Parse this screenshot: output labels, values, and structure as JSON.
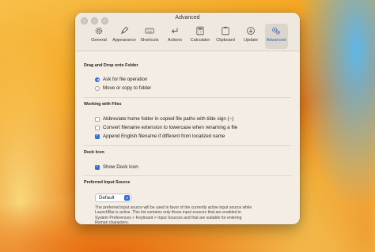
{
  "window": {
    "title": "Advanced"
  },
  "toolbar": {
    "items": [
      {
        "label": "General",
        "icon": "gear-icon"
      },
      {
        "label": "Appearance",
        "icon": "paintbrush-icon"
      },
      {
        "label": "Shortcuts",
        "icon": "keyboard-icon"
      },
      {
        "label": "Actions",
        "icon": "arrow-return-icon"
      },
      {
        "label": "Calculator",
        "icon": "calculator-icon"
      },
      {
        "label": "Clipboard",
        "icon": "clipboard-icon"
      },
      {
        "label": "Update",
        "icon": "download-circle-icon"
      },
      {
        "label": "Advanced",
        "icon": "gears-icon",
        "active": true
      }
    ]
  },
  "drag_drop": {
    "title": "Drag and Drop onto Folder",
    "ask_label": "Ask for file operation",
    "move_label": "Move or copy to folder",
    "selected": "ask"
  },
  "working_files": {
    "title": "Working with Files",
    "abbreviate_label": "Abbreviate home folder in copied file paths with tilde sign (~)",
    "abbreviate_checked": false,
    "lowercase_label": "Convert filename extension to lowercase when renaming a file",
    "lowercase_checked": false,
    "append_label": "Append English filename if different from localized name",
    "append_checked": true
  },
  "dock_icon": {
    "title": "Dock Icon",
    "show_label": "Show Dock Icon",
    "show_checked": true
  },
  "input_source": {
    "title": "Preferred Input Source",
    "selected": "Default",
    "description": "The preferred input source will be used in favor of the currently active input source while LaunchBar is active. This list contains only those input sources that are enabled in System Preferences > Keyboard > Input Sources and that are suitable for entering Roman characters."
  },
  "colors": {
    "accent": "#2f6fd6"
  }
}
